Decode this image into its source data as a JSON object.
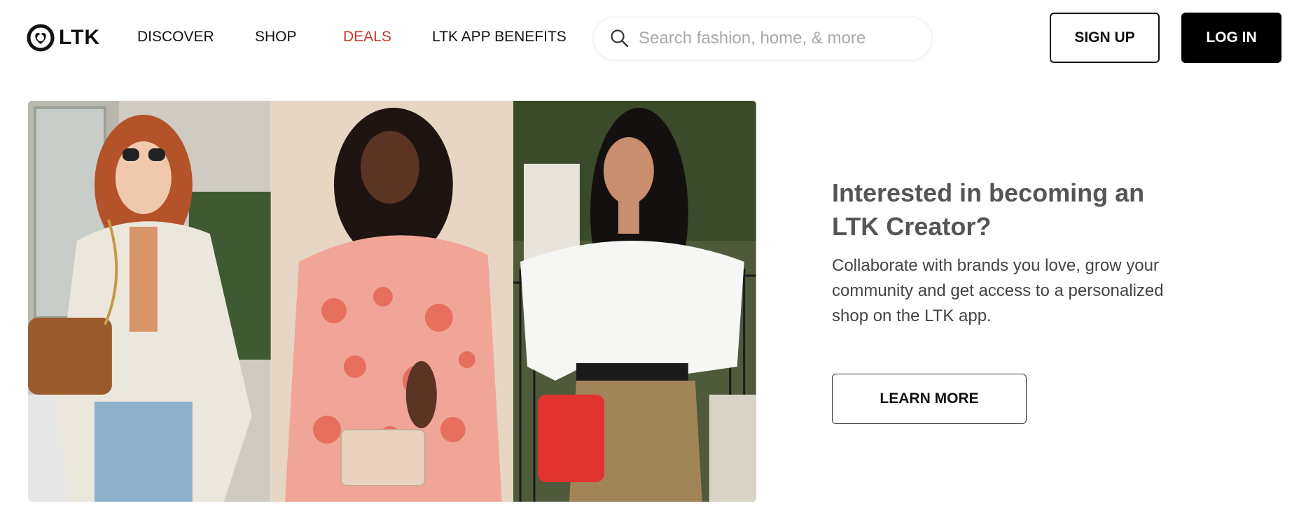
{
  "header": {
    "logo_text": "LTK",
    "nav": [
      {
        "label": "DISCOVER"
      },
      {
        "label": "SHOP"
      },
      {
        "label": "DEALS"
      },
      {
        "label": "LTK APP BENEFITS"
      }
    ],
    "search": {
      "placeholder": "Search fashion, home, & more",
      "value": ""
    },
    "signup_label": "SIGN UP",
    "login_label": "LOG IN"
  },
  "promo": {
    "title": "Interested in becoming an LTK Creator?",
    "body": "Collaborate with brands you love, grow your community and get access to a personalized shop on the LTK app.",
    "button_label": "LEARN MORE"
  },
  "colors": {
    "deals": "#c0392b",
    "primary": "#000000",
    "title": "#555555"
  },
  "icons": {
    "logo": "ltk-heart-logo-icon",
    "search": "search-icon"
  }
}
